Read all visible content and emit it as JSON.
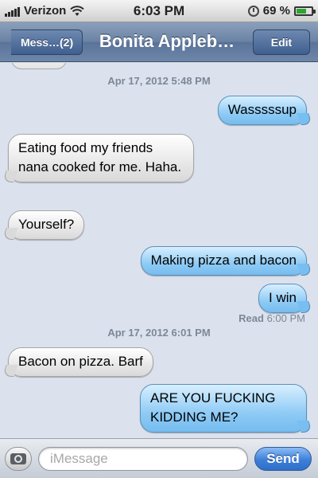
{
  "status_bar": {
    "carrier": "Verizon",
    "time": "6:03 PM",
    "battery_percent": "69 %",
    "battery_level": 0.69,
    "signal_bars": 5
  },
  "nav": {
    "back_label": "Mess…(2)",
    "title": "Bonita Appleb…",
    "edit_label": "Edit"
  },
  "conversation": {
    "timestamps": [
      "Apr 17, 2012 5:48 PM",
      "Apr 17, 2012 6:01 PM"
    ],
    "messages": [
      {
        "direction": "out",
        "text": "Wasssssup"
      },
      {
        "direction": "in",
        "text": "Eating food my friends nana cooked for me. Haha."
      },
      {
        "direction": "in",
        "text": "Yourself?"
      },
      {
        "direction": "out",
        "text": "Making pizza and bacon"
      },
      {
        "direction": "out",
        "text": "I win"
      },
      {
        "direction": "in",
        "text": "Bacon on pizza. Barf"
      },
      {
        "direction": "out",
        "text": "ARE YOU FUCKING KIDDING ME?"
      }
    ],
    "read_receipt": {
      "label": "Read",
      "time": "6:00 PM"
    }
  },
  "composer": {
    "placeholder": "iMessage",
    "send_label": "Send"
  },
  "icons": {
    "camera": "camera-icon",
    "wifi": "wifi-icon",
    "alarm": "alarm-icon",
    "battery": "battery-icon",
    "signal": "signal-icon"
  },
  "colors": {
    "background": "#dbe2ed",
    "nav_bar": "#6a82a3",
    "outgoing_bubble": "#8fcbf5",
    "incoming_bubble": "#e4e4e4",
    "send_button": "#3d7fd8",
    "battery_fill": "#2ea52e"
  }
}
